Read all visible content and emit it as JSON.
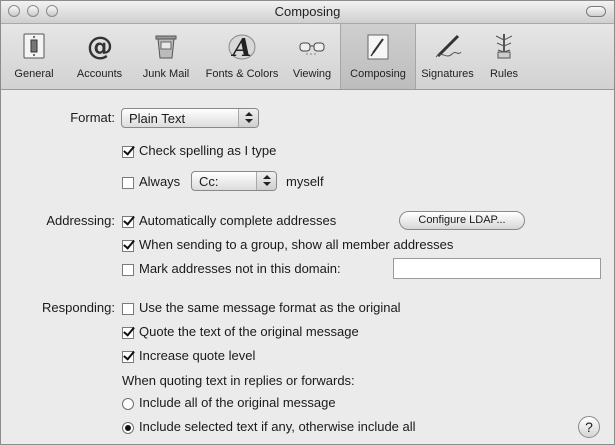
{
  "window": {
    "title": "Composing",
    "traffic_lights": [
      "close-button",
      "minimize-button",
      "zoom-button"
    ]
  },
  "toolbar": {
    "items": [
      {
        "label": "General",
        "icon": "light-switch-icon",
        "active": false
      },
      {
        "label": "Accounts",
        "icon": "at-sign-icon",
        "active": false
      },
      {
        "label": "Junk Mail",
        "icon": "trash-can-icon",
        "active": false
      },
      {
        "label": "Fonts & Colors",
        "icon": "font-a-icon",
        "active": false
      },
      {
        "label": "Viewing",
        "icon": "glasses-icon",
        "active": false
      },
      {
        "label": "Composing",
        "icon": "pencil-paper-icon",
        "active": true
      },
      {
        "label": "Signatures",
        "icon": "signature-pen-icon",
        "active": false
      },
      {
        "label": "Rules",
        "icon": "rules-icon",
        "active": false
      }
    ]
  },
  "format": {
    "label": "Format:",
    "value": "Plain Text",
    "spell_check_label": "Check spelling as I type",
    "spell_check_checked": true,
    "always_label": "Always",
    "always_checked": false,
    "cc_value": "Cc:",
    "myself_label": "myself"
  },
  "addressing": {
    "label": "Addressing:",
    "autocomplete_label": "Automatically complete addresses",
    "autocomplete_checked": true,
    "configure_ldap_label": "Configure LDAP...",
    "group_label": "When sending to a group, show all member addresses",
    "group_checked": true,
    "mark_label": "Mark addresses not in this domain:",
    "mark_checked": false,
    "domain_value": ""
  },
  "responding": {
    "label": "Responding:",
    "same_format_label": "Use the same message format as the original",
    "same_format_checked": false,
    "quote_label": "Quote the text of the original message",
    "quote_checked": true,
    "increase_label": "Increase quote level",
    "increase_checked": true,
    "when_quoting_label": "When quoting text in replies or forwards:",
    "include_all_label": "Include all of the original message",
    "include_selected_label": "Include selected text if any, otherwise include all",
    "selected_option": "include_selected"
  },
  "help": {
    "label": "?"
  }
}
